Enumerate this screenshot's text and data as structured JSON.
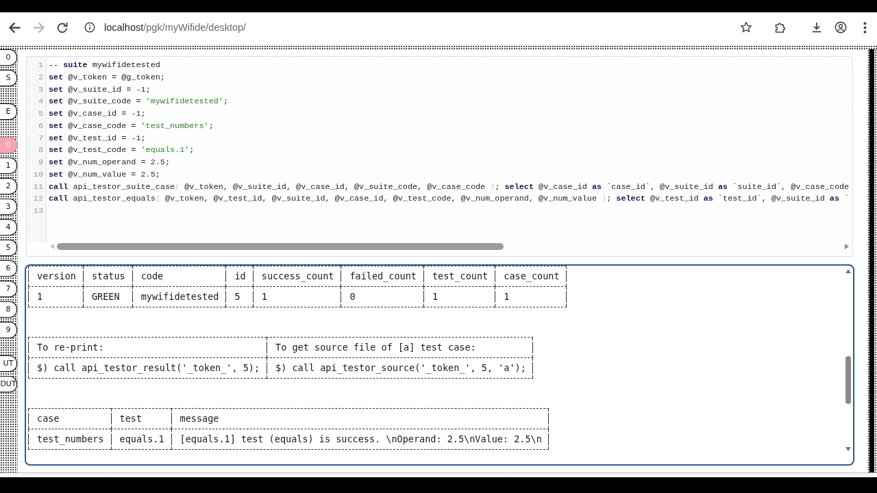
{
  "browser": {
    "back": {
      "disabled": false
    },
    "forward": {
      "disabled": true
    },
    "url_host": "localhost",
    "url_path": "/pgk/myWifide/desktop/"
  },
  "side_tab_groups": [
    {
      "tabs": [
        {
          "label": "0",
          "selected": false
        },
        {
          "label": "S",
          "selected": false
        }
      ]
    },
    {
      "tabs": [
        {
          "label": "E",
          "selected": false
        }
      ]
    },
    {
      "tabs": [
        {
          "label": "0",
          "selected": true
        },
        {
          "label": "1",
          "selected": false
        },
        {
          "label": "2",
          "selected": false
        },
        {
          "label": "3",
          "selected": false
        },
        {
          "label": "4",
          "selected": false
        },
        {
          "label": "5",
          "selected": false
        },
        {
          "label": "6",
          "selected": false
        },
        {
          "label": "7",
          "selected": false
        },
        {
          "label": "8",
          "selected": false
        },
        {
          "label": "9",
          "selected": false
        }
      ]
    },
    {
      "tabs": [
        {
          "label": "UT",
          "selected": false
        },
        {
          "label": "DUT",
          "selected": false
        }
      ]
    }
  ],
  "editor": {
    "lines": [
      {
        "number": "1",
        "tokens": [
          {
            "kind": "plain",
            "text": "-- "
          },
          {
            "kind": "keyword",
            "text": "suite"
          },
          {
            "kind": "plain",
            "text": " mywifidetested"
          }
        ]
      },
      {
        "number": "2",
        "tokens": [
          {
            "kind": "keyword",
            "text": "set"
          },
          {
            "kind": "plain",
            "text": " @v_token = @g_token;"
          }
        ]
      },
      {
        "number": "3",
        "tokens": [
          {
            "kind": "keyword",
            "text": "set"
          },
          {
            "kind": "plain",
            "text": " @v_suite_id = "
          },
          {
            "kind": "number",
            "text": "-1"
          },
          {
            "kind": "plain",
            "text": ";"
          }
        ]
      },
      {
        "number": "4",
        "tokens": [
          {
            "kind": "keyword",
            "text": "set"
          },
          {
            "kind": "plain",
            "text": " @v_suite_code = "
          },
          {
            "kind": "string",
            "text": "'mywifidetested'"
          },
          {
            "kind": "plain",
            "text": ";"
          }
        ]
      },
      {
        "number": "5",
        "tokens": [
          {
            "kind": "keyword",
            "text": "set"
          },
          {
            "kind": "plain",
            "text": " @v_case_id = "
          },
          {
            "kind": "number",
            "text": "-1"
          },
          {
            "kind": "plain",
            "text": ";"
          }
        ]
      },
      {
        "number": "6",
        "tokens": [
          {
            "kind": "keyword",
            "text": "set"
          },
          {
            "kind": "plain",
            "text": " @v_case_code = "
          },
          {
            "kind": "string",
            "text": "'test_numbers'"
          },
          {
            "kind": "plain",
            "text": ";"
          }
        ]
      },
      {
        "number": "7",
        "tokens": [
          {
            "kind": "keyword",
            "text": "set"
          },
          {
            "kind": "plain",
            "text": " @v_test_id = "
          },
          {
            "kind": "number",
            "text": "-1"
          },
          {
            "kind": "plain",
            "text": ";"
          }
        ]
      },
      {
        "number": "8",
        "tokens": [
          {
            "kind": "keyword",
            "text": "set"
          },
          {
            "kind": "plain",
            "text": " @v_test_code = "
          },
          {
            "kind": "string",
            "text": "'equals.1'"
          },
          {
            "kind": "plain",
            "text": ";"
          }
        ]
      },
      {
        "number": "9",
        "tokens": [
          {
            "kind": "keyword",
            "text": "set"
          },
          {
            "kind": "plain",
            "text": " @v_num_operand = "
          },
          {
            "kind": "number",
            "text": "2.5"
          },
          {
            "kind": "plain",
            "text": ";"
          }
        ]
      },
      {
        "number": "10",
        "tokens": [
          {
            "kind": "keyword",
            "text": "set"
          },
          {
            "kind": "plain",
            "text": " @v_num_value = "
          },
          {
            "kind": "number",
            "text": "2.5"
          },
          {
            "kind": "plain",
            "text": ";"
          }
        ]
      },
      {
        "number": "11",
        "tokens": [
          {
            "kind": "keyword",
            "text": "call"
          },
          {
            "kind": "plain",
            "text": " api_testor_suite_case"
          },
          {
            "kind": "bracket",
            "text": "("
          },
          {
            "kind": "plain",
            "text": " @v_token, @v_suite_id, @v_case_id, @v_suite_code, @v_case_code "
          },
          {
            "kind": "bracket",
            "text": ")"
          },
          {
            "kind": "plain",
            "text": "; "
          },
          {
            "kind": "keyword",
            "text": "select"
          },
          {
            "kind": "plain",
            "text": " @v_case_id "
          },
          {
            "kind": "keyword",
            "text": "as"
          },
          {
            "kind": "plain",
            "text": " `case_id`, @v_suite_id "
          },
          {
            "kind": "keyword",
            "text": "as"
          },
          {
            "kind": "plain",
            "text": " `suite_id`, @v_case_code"
          }
        ]
      },
      {
        "number": "12",
        "tokens": [
          {
            "kind": "keyword",
            "text": "call"
          },
          {
            "kind": "plain",
            "text": " api_testor_equals"
          },
          {
            "kind": "bracket",
            "text": "("
          },
          {
            "kind": "plain",
            "text": " @v_token, @v_test_id, @v_suite_id, @v_case_id, @v_test_code, @v_num_operand, @v_num_value "
          },
          {
            "kind": "bracket",
            "text": ")"
          },
          {
            "kind": "plain",
            "text": "; "
          },
          {
            "kind": "keyword",
            "text": "select"
          },
          {
            "kind": "plain",
            "text": " @v_test_id "
          },
          {
            "kind": "keyword",
            "text": "as"
          },
          {
            "kind": "plain",
            "text": " `test_id`, @v_suite_id "
          },
          {
            "kind": "keyword",
            "text": "as"
          },
          {
            "kind": "plain",
            "text": " `"
          }
        ]
      },
      {
        "number": "13"
      }
    ]
  },
  "output": {
    "tables": [
      {
        "columns": [
          "version",
          "status",
          "code",
          "id",
          "success_count",
          "failed_count",
          "test_count",
          "case_count"
        ],
        "rows": [
          [
            "1",
            "GREEN",
            "mywifidetested",
            "5",
            "1",
            "0",
            "1",
            "1"
          ]
        ]
      },
      {
        "columns": [
          "To re-print:",
          "To get source file of [a] test case:"
        ],
        "rows": [
          [
            "$) call api_testor_result('_token_', 5);",
            "$) call api_testor_source('_token_', 5, 'a');"
          ]
        ]
      },
      {
        "columns": [
          "case",
          "test",
          "message"
        ],
        "rows": [
          [
            "test_numbers",
            "equals.1",
            "[equals.1] test (equals) is success. \\nOperand: 2.5\\nValue: 2.5\\n"
          ]
        ]
      }
    ]
  }
}
